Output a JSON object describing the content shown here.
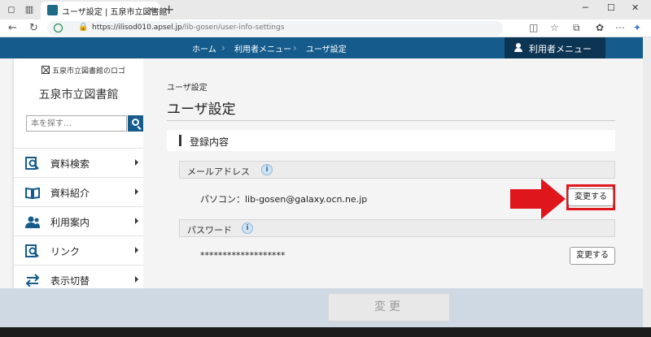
{
  "browser": {
    "tab_title": "ユーザ設定 | 五泉市立図書館",
    "tab_close": "×",
    "new_tab": "+",
    "url_host": "https://ilisod010.apsel.jp",
    "url_path": "/lib-gosen/user-info-settings"
  },
  "header": {
    "breadcrumbs": [
      "ホーム",
      "利用者メニュー",
      "ユーザ設定"
    ],
    "user_menu": "利用者メニュー"
  },
  "sidebar": {
    "logo_alt": "五泉市立図書館のロゴ",
    "library_name": "五泉市立図書館",
    "search_placeholder": "本を探す…",
    "items": [
      {
        "label": "資料検索",
        "icon": "book-search-icon"
      },
      {
        "label": "資料紹介",
        "icon": "open-book-icon"
      },
      {
        "label": "利用案内",
        "icon": "people-icon"
      },
      {
        "label": "リンク",
        "icon": "link-search-icon"
      },
      {
        "label": "表示切替",
        "icon": "swap-arrows-icon"
      }
    ]
  },
  "main": {
    "small_title": "ユーザ設定",
    "page_title": "ユーザ設定",
    "section_title": "登録内容",
    "email": {
      "label": "メールアドレス",
      "info": "i",
      "value": "パソコン：lib-gosen@galaxy.ocn.ne.jp",
      "button": "変更する"
    },
    "password": {
      "label": "パスワード",
      "info": "i",
      "value": "*******************",
      "button": "変更する"
    },
    "submit": "変更"
  },
  "colors": {
    "header": "#155c8c",
    "user_menu": "#0c3554",
    "highlight": "#e0161d",
    "footer": "#cfd9e3"
  }
}
